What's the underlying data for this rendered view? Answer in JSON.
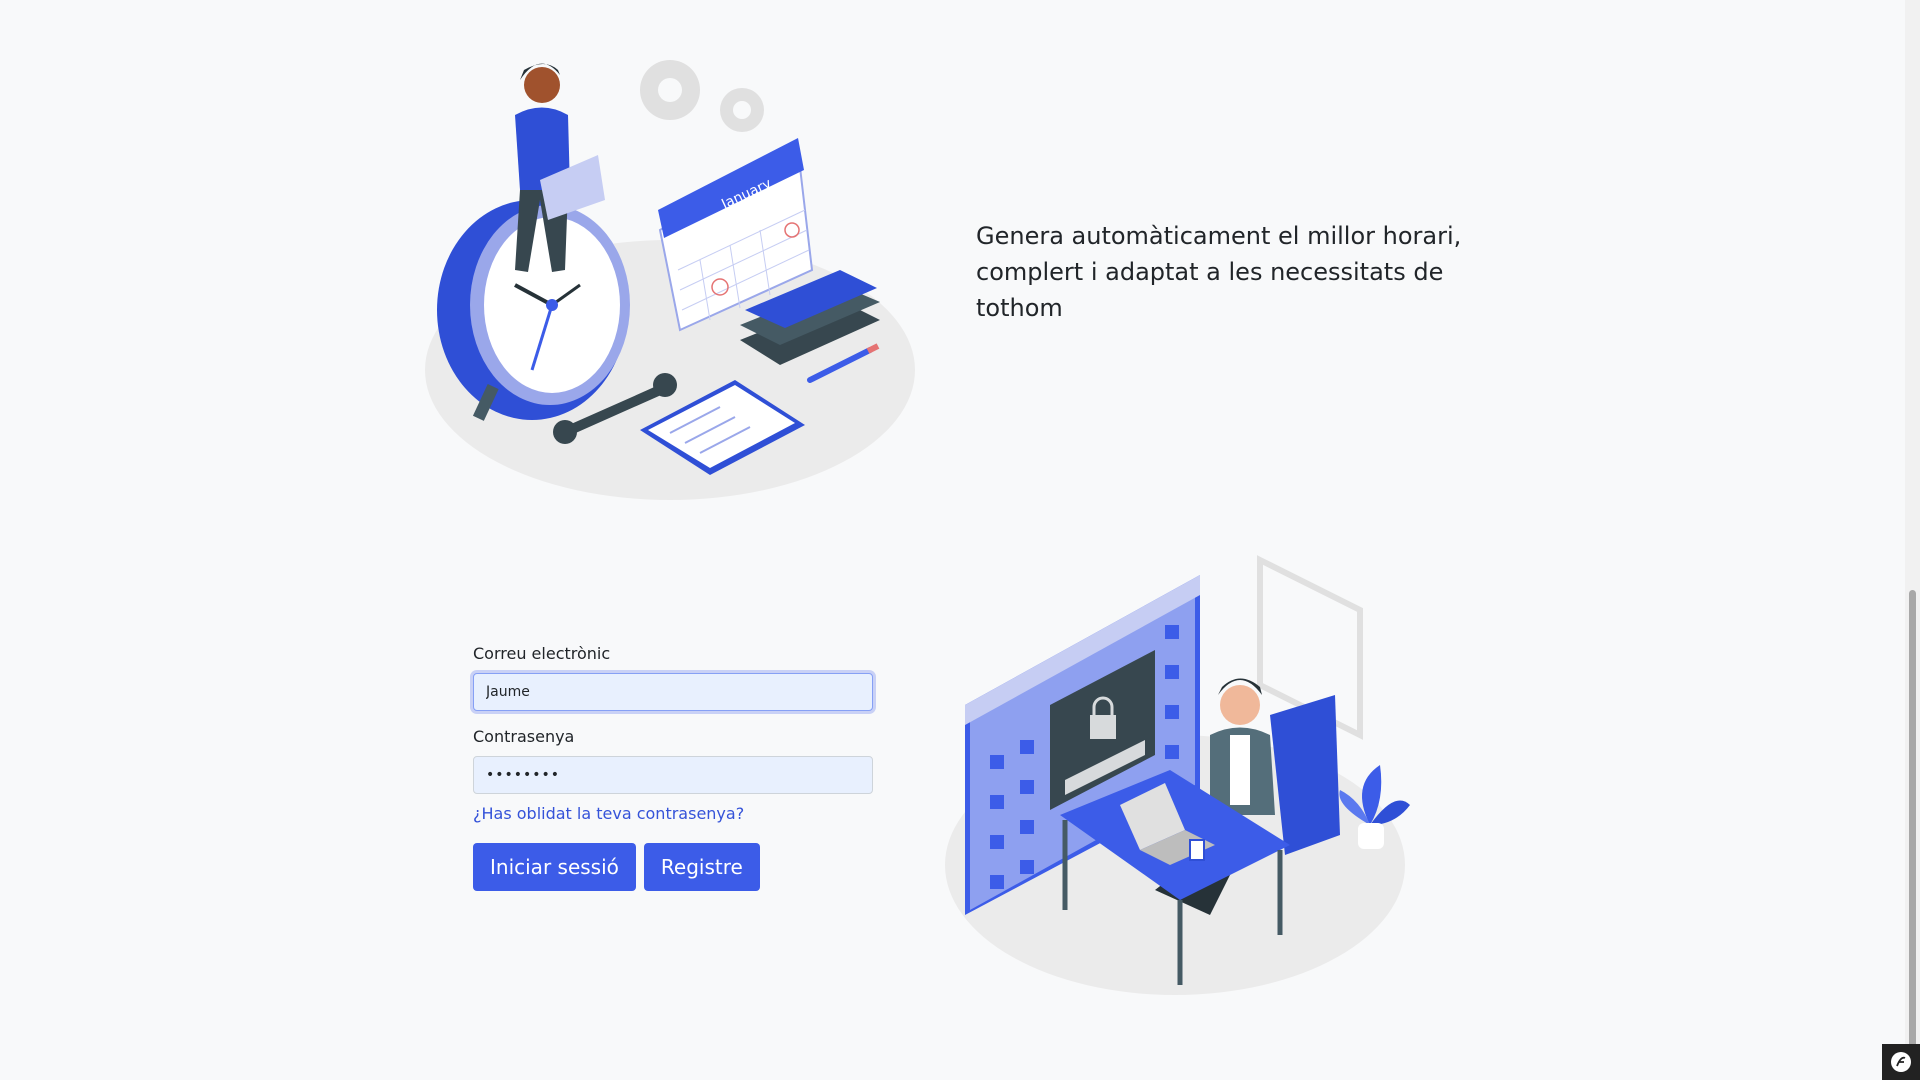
{
  "tagline": {
    "line1": "Genera automàticament el millor horari,",
    "line2": "complert i adaptat a les necessitats de tothom"
  },
  "illustration_top": {
    "calendar_label": "January",
    "icons": [
      "alarm-clock-icon",
      "gear-icon",
      "calendar-icon",
      "books-icon",
      "clipboard-icon",
      "wrench-icon",
      "pencil-icon",
      "laptop-icon"
    ]
  },
  "illustration_bottom": {
    "icons": [
      "browser-window-icon",
      "padlock-icon",
      "desk-icon",
      "plant-icon",
      "laptop-icon"
    ]
  },
  "login": {
    "email_label": "Correu electrònic",
    "email_value": "Jaume",
    "password_label": "Contrasenya",
    "password_value": "••••••••",
    "forgot_link": "¿Has oblidat la teva contrasenya?",
    "login_button": "Iniciar sessió",
    "register_button": "Registre"
  },
  "colors": {
    "accent": "#3c5ce8",
    "link": "#3553d9",
    "input_background": "#e8f0fe",
    "page_background": "#f8f9fa"
  },
  "toolbar": {
    "icon": "symfony-icon"
  }
}
